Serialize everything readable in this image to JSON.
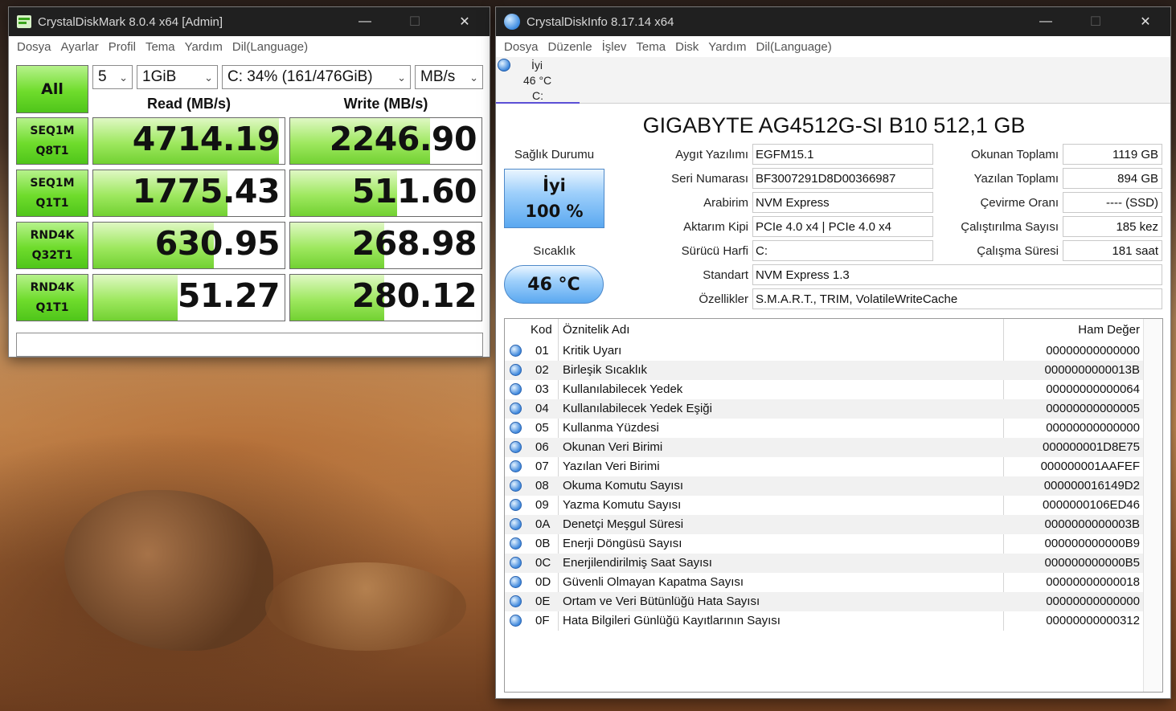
{
  "cdm": {
    "title": "CrystalDiskMark 8.0.4 x64 [Admin]",
    "menu": [
      "Dosya",
      "Ayarlar",
      "Profil",
      "Tema",
      "Yardım",
      "Dil(Language)"
    ],
    "all_label": "All",
    "count": "5",
    "size": "1GiB",
    "drive": "C: 34% (161/476GiB)",
    "unit": "MB/s",
    "read_header": "Read (MB/s)",
    "write_header": "Write (MB/s)",
    "tests": [
      {
        "l1": "SEQ1M",
        "l2": "Q8T1",
        "read": "4714.19",
        "write": "2246.90",
        "read_fill": 0.97,
        "write_fill": 0.73
      },
      {
        "l1": "SEQ1M",
        "l2": "Q1T1",
        "read": "1775.43",
        "write": "511.60",
        "read_fill": 0.7,
        "write_fill": 0.56
      },
      {
        "l1": "RND4K",
        "l2": "Q32T1",
        "read": "630.95",
        "write": "268.98",
        "read_fill": 0.63,
        "write_fill": 0.49
      },
      {
        "l1": "RND4K",
        "l2": "Q1T1",
        "read": "51.27",
        "write": "280.12",
        "read_fill": 0.44,
        "write_fill": 0.49
      }
    ],
    "status": ""
  },
  "cdi": {
    "title": "CrystalDiskInfo 8.17.14 x64",
    "menu": [
      "Dosya",
      "Düzenle",
      "İşlev",
      "Tema",
      "Disk",
      "Yardım",
      "Dil(Language)"
    ],
    "drive_tab": {
      "health": "İyi",
      "temp": "46 °C",
      "letter": "C:"
    },
    "model": "GIGABYTE AG4512G-SI B10 512,1 GB",
    "health_label": "Sağlık Durumu",
    "health_status": "İyi",
    "health_percent": "100 %",
    "temp_label": "Sıcaklık",
    "temp_value": "46 °C",
    "fields": {
      "firmware_label": "Aygıt Yazılımı",
      "firmware": "EGFM15.1",
      "serial_label": "Seri Numarası",
      "serial": "BF3007291D8D00366987",
      "interface_label": "Arabirim",
      "interface": "NVM Express",
      "transfer_label": "Aktarım Kipi",
      "transfer": "PCIe 4.0 x4 | PCIe 4.0 x4",
      "letter_label": "Sürücü Harfi",
      "letter": "C:",
      "standard_label": "Standart",
      "standard": "NVM Express 1.3",
      "features_label": "Özellikler",
      "features": "S.M.A.R.T., TRIM, VolatileWriteCache",
      "reads_label": "Okunan Toplamı",
      "reads": "1119 GB",
      "writes_label": "Yazılan Toplamı",
      "writes": "894 GB",
      "rpm_label": "Çevirme Oranı",
      "rpm": "---- (SSD)",
      "power_on_count_label": "Çalıştırılma Sayısı",
      "power_on_count": "185 kez",
      "power_on_hours_label": "Çalışma Süresi",
      "power_on_hours": "181 saat"
    },
    "smart_headers": {
      "code": "Kod",
      "name": "Öznitelik Adı",
      "raw": "Ham Değer"
    },
    "smart": [
      {
        "code": "01",
        "name": "Kritik Uyarı",
        "raw": "00000000000000"
      },
      {
        "code": "02",
        "name": "Birleşik Sıcaklık",
        "raw": "0000000000013B"
      },
      {
        "code": "03",
        "name": "Kullanılabilecek Yedek",
        "raw": "00000000000064"
      },
      {
        "code": "04",
        "name": "Kullanılabilecek Yedek Eşiği",
        "raw": "00000000000005"
      },
      {
        "code": "05",
        "name": "Kullanma Yüzdesi",
        "raw": "00000000000000"
      },
      {
        "code": "06",
        "name": "Okunan Veri Birimi",
        "raw": "000000001D8E75"
      },
      {
        "code": "07",
        "name": "Yazılan Veri Birimi",
        "raw": "000000001AAFEF"
      },
      {
        "code": "08",
        "name": "Okuma Komutu Sayısı",
        "raw": "000000016149D2"
      },
      {
        "code": "09",
        "name": "Yazma Komutu Sayısı",
        "raw": "0000000106ED46"
      },
      {
        "code": "0A",
        "name": "Denetçi Meşgul Süresi",
        "raw": "0000000000003B"
      },
      {
        "code": "0B",
        "name": "Enerji Döngüsü Sayısı",
        "raw": "000000000000B9"
      },
      {
        "code": "0C",
        "name": "Enerjilendirilmiş Saat Sayısı",
        "raw": "000000000000B5"
      },
      {
        "code": "0D",
        "name": "Güvenli Olmayan Kapatma Sayısı",
        "raw": "00000000000018"
      },
      {
        "code": "0E",
        "name": "Ortam ve Veri Bütünlüğü Hata Sayısı",
        "raw": "00000000000000"
      },
      {
        "code": "0F",
        "name": "Hata Bilgileri Günlüğü Kayıtlarının Sayısı",
        "raw": "00000000000312"
      }
    ]
  },
  "icons": {
    "minimize": "minimize-icon",
    "maximize": "maximize-icon",
    "close": "close-icon"
  },
  "colors": {
    "bar_green": "#72d132",
    "health_blue": "#5aa8f0",
    "titlebar": "#202020"
  }
}
